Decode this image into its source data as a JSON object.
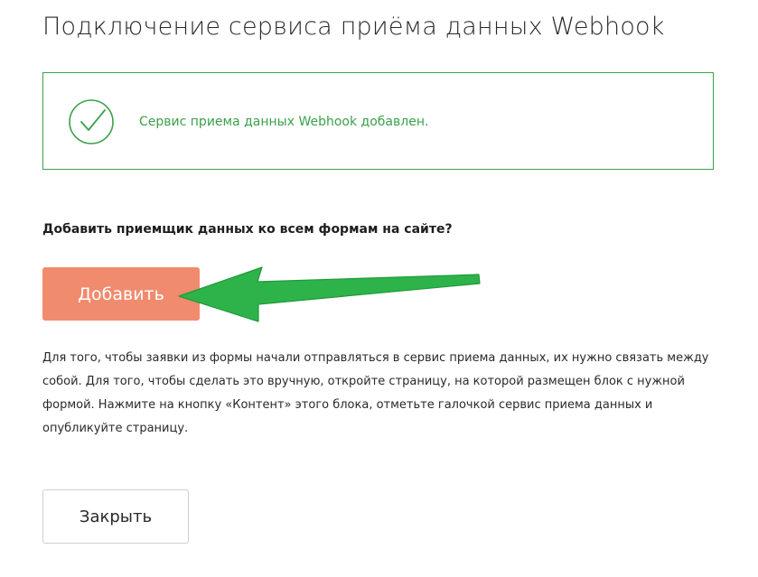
{
  "page": {
    "title": "Подключение сервиса приёма данных Webhook"
  },
  "success": {
    "message": "Сервис приема данных Webhook добавлен.",
    "icon": "checkmark-circle-icon",
    "color": "#3aa14a"
  },
  "prompt": {
    "question": "Добавить приемщик данных ко всем формам на сайте?",
    "add_label": "Добавить",
    "add_color": "#f08b6e"
  },
  "annotation": {
    "icon": "green-arrow-icon",
    "color": "#2db34a"
  },
  "help": {
    "text": "Для того, чтобы заявки из формы начали отправляться в сервис приема данных, их нужно связать между собой. Для того, чтобы сделать это вручную, откройте страницу, на которой размещен блок с нужной формой. Нажмите на кнопку «Контент» этого блока, отметьте галочкой сервис приема данных и опубликуйте страницу."
  },
  "footer": {
    "close_label": "Закрыть"
  }
}
